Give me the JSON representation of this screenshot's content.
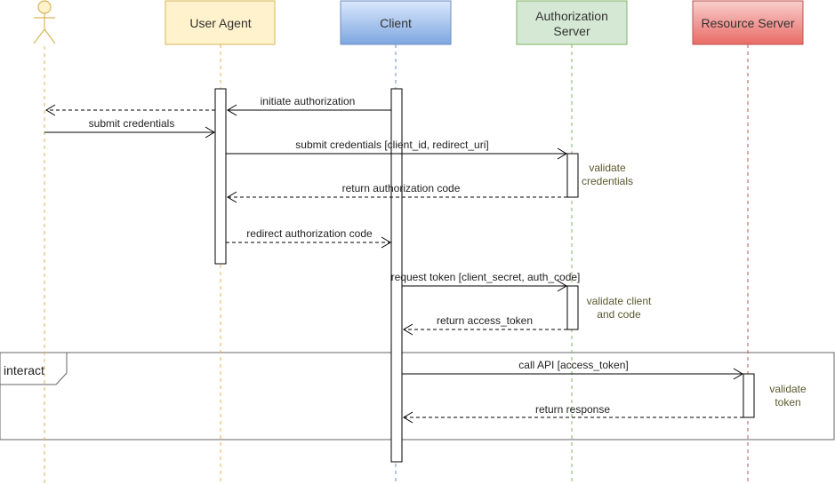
{
  "diagram": {
    "type": "sequence",
    "actor": {
      "id": "user",
      "label": "",
      "icon": "stick-figure-icon",
      "color": "#d6b656"
    },
    "participants": [
      {
        "id": "user_agent",
        "label": "User Agent",
        "lines": [
          "User Agent"
        ],
        "fill": "#fff2cc",
        "stroke": "#d6b656",
        "lifeline": "#e8b24a"
      },
      {
        "id": "client",
        "label": "Client",
        "lines": [
          "Client"
        ],
        "fill": "#a9c4eb",
        "stroke": "#6c8ebf",
        "lifeline": "#6c8ebf"
      },
      {
        "id": "auth_server",
        "label": "Authorization Server",
        "lines": [
          "Authorization",
          "Server"
        ],
        "fill": "#d5e8d4",
        "stroke": "#82b366",
        "lifeline": "#82b366"
      },
      {
        "id": "resource_server",
        "label": "Resource Server",
        "lines": [
          "Resource Server"
        ],
        "fill": "#f19c99",
        "stroke": "#b85450",
        "lifeline": "#b85450"
      }
    ],
    "messages": [
      {
        "from": "client",
        "to": "user_agent",
        "label": "initiate authorization",
        "style": "solid"
      },
      {
        "from": "user_agent",
        "to": "user",
        "label": "",
        "style": "dashed"
      },
      {
        "from": "user",
        "to": "user_agent",
        "label": "submit credentials",
        "style": "solid"
      },
      {
        "from": "user_agent",
        "to": "auth_server",
        "label": "submit credentials [client_id, redirect_uri]",
        "style": "solid"
      },
      {
        "from": "auth_server",
        "to": "user_agent",
        "label": "return authorization code",
        "style": "dashed"
      },
      {
        "from": "user_agent",
        "to": "client",
        "label": "redirect authorization code",
        "style": "dashed"
      },
      {
        "from": "client",
        "to": "auth_server",
        "label": "request token [client_secret, auth_code]",
        "style": "solid"
      },
      {
        "from": "auth_server",
        "to": "client",
        "label": "return access_token",
        "style": "dashed"
      },
      {
        "from": "client",
        "to": "resource_server",
        "label": "call API [access_token]",
        "style": "solid"
      },
      {
        "from": "resource_server",
        "to": "client",
        "label": "return response",
        "style": "dashed"
      }
    ],
    "notes": [
      {
        "participant": "auth_server",
        "lines": [
          "validate",
          "credentials"
        ]
      },
      {
        "participant": "auth_server",
        "lines": [
          "validate client",
          "and code"
        ]
      },
      {
        "participant": "resource_server",
        "lines": [
          "validate",
          "token"
        ]
      }
    ],
    "frame": {
      "label": "interact"
    },
    "note_color": "#5a5a2e"
  }
}
